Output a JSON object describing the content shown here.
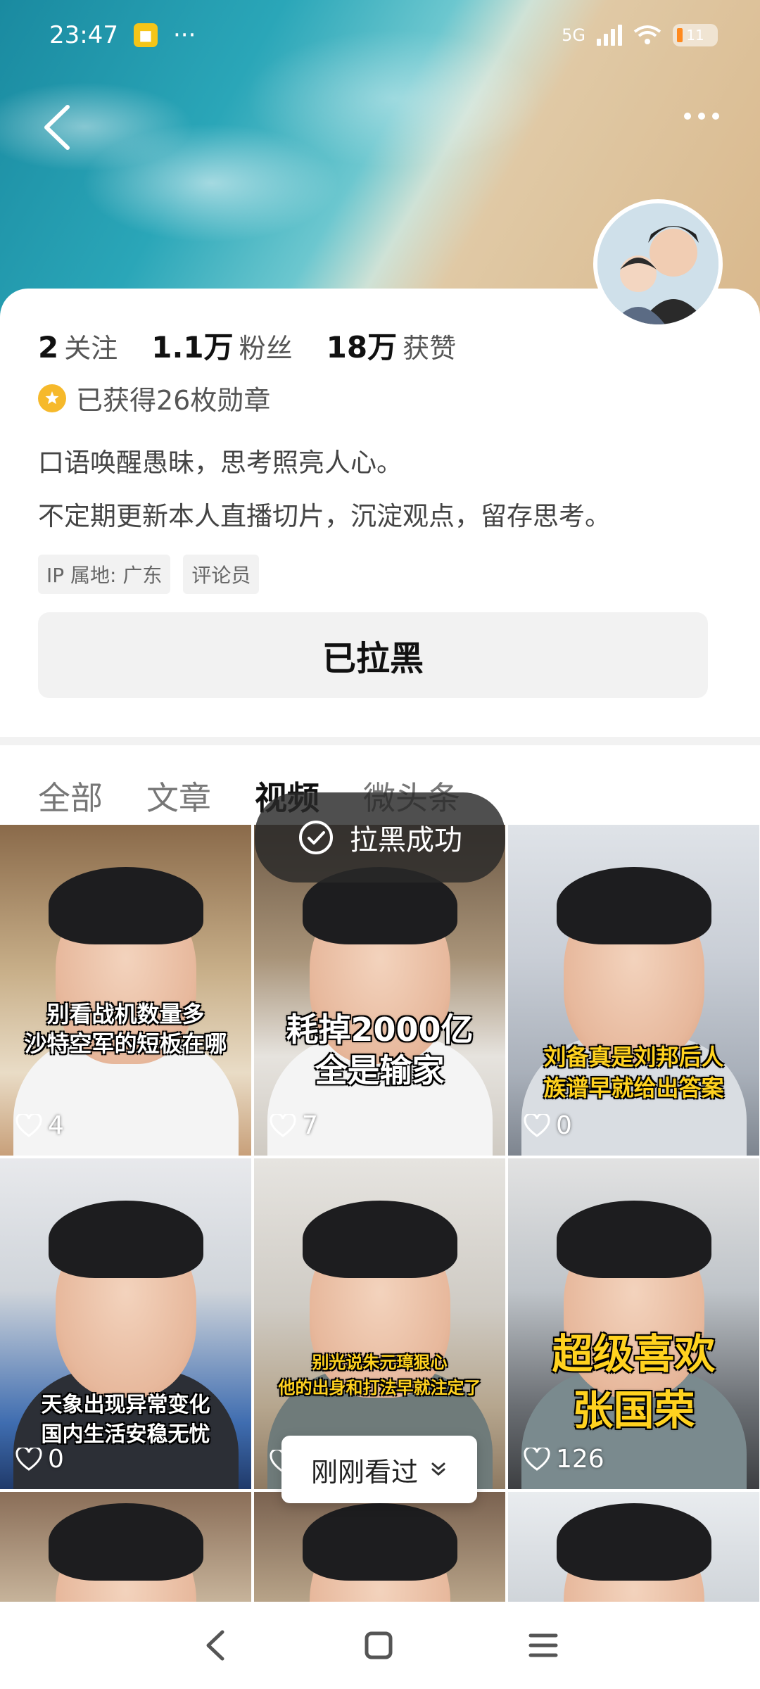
{
  "status_bar": {
    "time": "23:47",
    "more": "···",
    "network": "5G",
    "battery": "11"
  },
  "profile": {
    "stats": [
      {
        "num": "2",
        "label": "关注"
      },
      {
        "num": "1.1万",
        "label": "粉丝"
      },
      {
        "num": "18万",
        "label": "获赞"
      }
    ],
    "medal_text": "已获得26枚勋章",
    "bio_lines": [
      "口语唤醒愚昧，思考照亮人心。",
      "不定期更新本人直播切片，沉淀观点，留存思考。"
    ],
    "tags": [
      "IP 属地: 广东",
      "评论员"
    ],
    "blocked_button": "已拉黑"
  },
  "tabs": [
    {
      "label": "全部",
      "active": false
    },
    {
      "label": "文章",
      "active": false
    },
    {
      "label": "视频",
      "active": true
    },
    {
      "label": "微头条",
      "active": false
    }
  ],
  "toast": "拉黑成功",
  "videos": [
    {
      "caption": [
        "别看战机数量多",
        "沙特空军的短板在哪"
      ],
      "likes": "4"
    },
    {
      "caption": [
        "耗掉2000亿",
        "全是输家"
      ],
      "likes": "7"
    },
    {
      "caption": [
        "刘备真是刘邦后人",
        "族谱早就给出答案"
      ],
      "likes": "0"
    },
    {
      "caption": [
        "天象出现异常变化",
        "国内生活安稳无忧"
      ],
      "likes": "0"
    },
    {
      "caption": [
        "别光说朱元璋狠心",
        "他的出身和打法早就注定了"
      ],
      "likes": ""
    },
    {
      "caption": [
        "超级喜欢",
        "张国荣"
      ],
      "likes": "126"
    }
  ],
  "seen_pill": "刚刚看过",
  "colors": {
    "accent_medal": "#f6b92b",
    "toast_bg": "#282828",
    "caption_yellow": "#ffd21f"
  }
}
